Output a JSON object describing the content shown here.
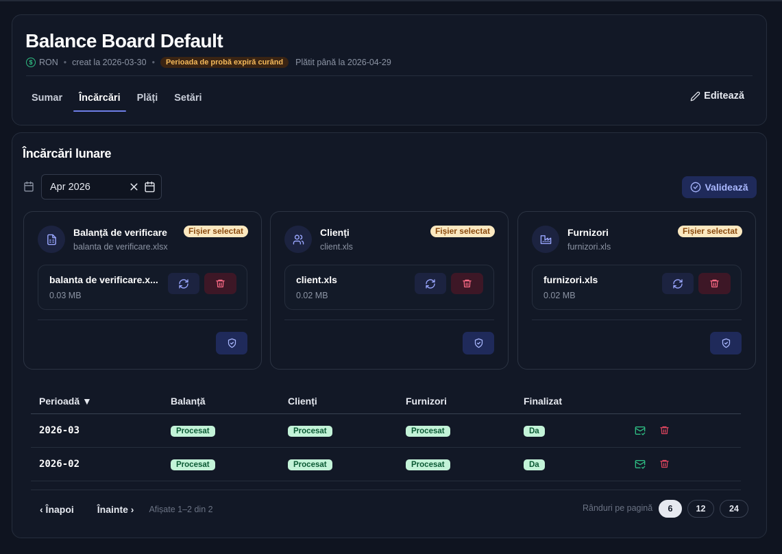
{
  "header": {
    "title": "Balance Board Default",
    "currency": "RON",
    "created": "creat la 2026-03-30",
    "trial_badge": "Perioada de probă expiră curând",
    "paid_until": "Plătit până la 2026-04-29",
    "edit_label": "Editează",
    "tabs": [
      {
        "label": "Sumar",
        "active": false
      },
      {
        "label": "Încărcări",
        "active": true
      },
      {
        "label": "Plăți",
        "active": false
      },
      {
        "label": "Setări",
        "active": false
      }
    ]
  },
  "uploads": {
    "title": "Încărcări lunare",
    "month_value": "Apr 2026",
    "validate_label": "Validează",
    "cards": [
      {
        "title": "Balanță de verificare",
        "subtitle": "balanta de verificare.xlsx",
        "badge": "Fișier selectat",
        "file_name": "balanta de verificare.x...",
        "file_size": "0.03 MB",
        "icon": "document-icon"
      },
      {
        "title": "Clienți",
        "subtitle": "client.xls",
        "badge": "Fișier selectat",
        "file_name": "client.xls",
        "file_size": "0.02 MB",
        "icon": "users-icon"
      },
      {
        "title": "Furnizori",
        "subtitle": "furnizori.xls",
        "badge": "Fișier selectat",
        "file_name": "furnizori.xls",
        "file_size": "0.02 MB",
        "icon": "factory-icon"
      }
    ]
  },
  "table": {
    "headers": [
      "Perioadă ▼",
      "Balanță",
      "Clienți",
      "Furnizori",
      "Finalizat"
    ],
    "rows": [
      {
        "period": "2026-03",
        "balanta": "Procesat",
        "clienti": "Procesat",
        "furnizori": "Procesat",
        "finalizat": "Da"
      },
      {
        "period": "2026-02",
        "balanta": "Procesat",
        "clienti": "Procesat",
        "furnizori": "Procesat",
        "finalizat": "Da"
      }
    ]
  },
  "pagination": {
    "prev": "‹ Înapoi",
    "next": "Înainte ›",
    "info": "Afișate 1–2 din 2",
    "rows_label": "Rânduri pe pagină",
    "sizes": [
      "6",
      "12",
      "24"
    ],
    "selected_size": "6"
  },
  "colors": {
    "accent": "#6f7fe8",
    "success": "#2fbf84",
    "danger": "#e0455f",
    "warning": "#f5b95a"
  }
}
